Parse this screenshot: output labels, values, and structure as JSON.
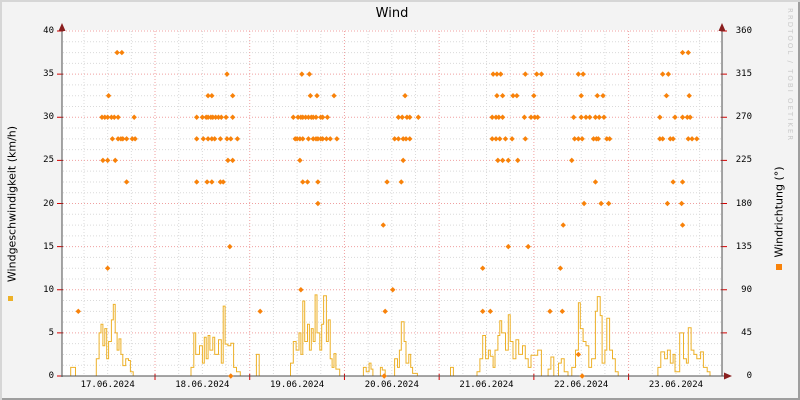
{
  "title": "Wind",
  "watermark": "RRDTOOL / TOBI OETIKER",
  "axes": {
    "left": {
      "label": "Windgeschwindigkeit (km/h)",
      "min": 0,
      "max": 40,
      "ticks": [
        0,
        5,
        10,
        15,
        20,
        25,
        30,
        35,
        40
      ]
    },
    "right": {
      "label": "Windrichtung (°)",
      "min": 0,
      "max": 360,
      "ticks": [
        0,
        45,
        90,
        135,
        180,
        225,
        270,
        315,
        360
      ]
    },
    "x": {
      "unit": "days since 17.06.2024 00:00",
      "t_min": 0.028,
      "t_max": 6.988,
      "day_labels": [
        {
          "t": 0.5,
          "text": "17.06.2024"
        },
        {
          "t": 1.5,
          "text": "18.06.2024"
        },
        {
          "t": 2.5,
          "text": "19.06.2024"
        },
        {
          "t": 3.5,
          "text": "20.06.2024"
        },
        {
          "t": 4.5,
          "text": "21.06.2024"
        },
        {
          "t": 5.5,
          "text": "22.06.2024"
        },
        {
          "t": 6.5,
          "text": "23.06.2024"
        }
      ]
    }
  },
  "colors": {
    "background": "#f3f3f3",
    "plot_background": "#ffffff",
    "grid_minor": "#dadada",
    "grid_major": "#f0a0a0",
    "tick_red": "#d40000",
    "axis": "#4d4d4d",
    "arrow": "#8a1f1f",
    "speed_line": "#edb128",
    "direction_point": "#f8820a",
    "watermark": "#c9c9c9"
  },
  "chart_data": {
    "type": "mixed",
    "title": "Wind",
    "grid": true,
    "legend_position": "axis-side-swatches",
    "x_unit": "days since 17.06.2024 00:00",
    "series": [
      {
        "name": "Windgeschwindigkeit",
        "type": "line",
        "style": "step",
        "axis": "left",
        "unit": "km/h",
        "ylim": [
          0,
          40
        ],
        "step_points": [
          [
            0.03,
            0
          ],
          [
            0.11,
            1
          ],
          [
            0.16,
            0
          ],
          [
            0.38,
            2
          ],
          [
            0.41,
            5
          ],
          [
            0.43,
            6
          ],
          [
            0.45,
            3.5
          ],
          [
            0.47,
            5.5
          ],
          [
            0.49,
            2
          ],
          [
            0.51,
            4
          ],
          [
            0.54,
            6.5
          ],
          [
            0.56,
            8.3
          ],
          [
            0.58,
            5
          ],
          [
            0.6,
            3
          ],
          [
            0.62,
            4.3
          ],
          [
            0.64,
            2.5
          ],
          [
            0.66,
            1.2
          ],
          [
            0.69,
            2
          ],
          [
            0.72,
            1.8
          ],
          [
            0.74,
            0.5
          ],
          [
            0.77,
            0
          ],
          [
            1.38,
            1
          ],
          [
            1.41,
            5
          ],
          [
            1.43,
            2.5
          ],
          [
            1.47,
            3.5
          ],
          [
            1.5,
            1.5
          ],
          [
            1.52,
            4.5
          ],
          [
            1.54,
            2
          ],
          [
            1.56,
            4.7
          ],
          [
            1.58,
            3
          ],
          [
            1.61,
            4.5
          ],
          [
            1.63,
            2.5
          ],
          [
            1.67,
            4.2
          ],
          [
            1.7,
            1.5
          ],
          [
            1.72,
            8.1
          ],
          [
            1.74,
            3.7
          ],
          [
            1.77,
            3.5
          ],
          [
            1.8,
            3.8
          ],
          [
            1.83,
            1
          ],
          [
            1.86,
            0.5
          ],
          [
            1.9,
            0
          ],
          [
            2.07,
            2.5
          ],
          [
            2.1,
            0
          ],
          [
            2.43,
            1.5
          ],
          [
            2.46,
            4
          ],
          [
            2.49,
            3
          ],
          [
            2.52,
            5
          ],
          [
            2.54,
            2.5
          ],
          [
            2.56,
            8.7
          ],
          [
            2.58,
            4
          ],
          [
            2.61,
            6
          ],
          [
            2.63,
            3
          ],
          [
            2.65,
            5.5
          ],
          [
            2.67,
            4
          ],
          [
            2.69,
            9.4
          ],
          [
            2.71,
            5
          ],
          [
            2.74,
            3
          ],
          [
            2.76,
            6
          ],
          [
            2.78,
            9.3
          ],
          [
            2.81,
            4
          ],
          [
            2.83,
            6.5
          ],
          [
            2.85,
            2
          ],
          [
            2.87,
            1
          ],
          [
            2.89,
            2.6
          ],
          [
            2.91,
            0.8
          ],
          [
            2.95,
            0
          ],
          [
            3.2,
            1
          ],
          [
            3.23,
            0.5
          ],
          [
            3.26,
            1.5
          ],
          [
            3.28,
            0.8
          ],
          [
            3.3,
            0
          ],
          [
            3.38,
            1
          ],
          [
            3.4,
            0.7
          ],
          [
            3.43,
            0
          ],
          [
            3.53,
            2
          ],
          [
            3.56,
            1
          ],
          [
            3.58,
            3
          ],
          [
            3.6,
            6.3
          ],
          [
            3.63,
            4
          ],
          [
            3.65,
            1.5
          ],
          [
            3.68,
            2.5
          ],
          [
            3.7,
            1
          ],
          [
            3.72,
            0.3
          ],
          [
            3.77,
            0
          ],
          [
            4.12,
            1
          ],
          [
            4.15,
            0
          ],
          [
            4.4,
            0.5
          ],
          [
            4.43,
            2
          ],
          [
            4.46,
            4.7
          ],
          [
            4.49,
            2
          ],
          [
            4.52,
            3
          ],
          [
            4.54,
            2.3
          ],
          [
            4.57,
            1
          ],
          [
            4.59,
            3
          ],
          [
            4.62,
            4.7
          ],
          [
            4.64,
            6.4
          ],
          [
            4.66,
            5
          ],
          [
            4.7,
            3
          ],
          [
            4.73,
            7.1
          ],
          [
            4.75,
            4
          ],
          [
            4.78,
            2
          ],
          [
            4.81,
            4.2
          ],
          [
            4.84,
            2.5
          ],
          [
            4.88,
            3.5
          ],
          [
            4.91,
            2
          ],
          [
            4.94,
            1
          ],
          [
            4.97,
            2.4
          ],
          [
            5.04,
            3
          ],
          [
            5.08,
            0
          ],
          [
            5.15,
            0.8
          ],
          [
            5.18,
            2.2
          ],
          [
            5.21,
            0
          ],
          [
            5.26,
            1.5
          ],
          [
            5.29,
            2
          ],
          [
            5.32,
            0.5
          ],
          [
            5.36,
            0
          ],
          [
            5.4,
            1
          ],
          [
            5.44,
            3
          ],
          [
            5.47,
            8.5
          ],
          [
            5.49,
            5.5
          ],
          [
            5.52,
            4
          ],
          [
            5.55,
            3.5
          ],
          [
            5.58,
            1
          ],
          [
            5.61,
            2
          ],
          [
            5.65,
            7.5
          ],
          [
            5.67,
            9.2
          ],
          [
            5.7,
            7
          ],
          [
            5.72,
            1.5
          ],
          [
            5.75,
            3
          ],
          [
            5.77,
            6.7
          ],
          [
            5.8,
            3
          ],
          [
            5.83,
            2
          ],
          [
            5.86,
            0.5
          ],
          [
            5.89,
            0
          ],
          [
            6.31,
            1
          ],
          [
            6.34,
            2.8
          ],
          [
            6.38,
            2
          ],
          [
            6.41,
            3
          ],
          [
            6.44,
            1.5
          ],
          [
            6.47,
            2.5
          ],
          [
            6.49,
            0.5
          ],
          [
            6.54,
            5
          ],
          [
            6.58,
            2
          ],
          [
            6.61,
            1.5
          ],
          [
            6.63,
            5.6
          ],
          [
            6.66,
            3
          ],
          [
            6.69,
            2.5
          ],
          [
            6.72,
            2
          ],
          [
            6.76,
            2.8
          ],
          [
            6.79,
            1
          ],
          [
            6.83,
            0.5
          ],
          [
            6.86,
            0
          ],
          [
            6.99,
            0
          ]
        ]
      },
      {
        "name": "Windrichtung",
        "type": "scatter",
        "marker": "diamond",
        "axis": "right",
        "unit": "deg",
        "ylim": [
          0,
          360
        ],
        "groups": [
          {
            "deg": 337.5,
            "t": [
              0.6,
              0.65,
              6.57,
              6.63
            ]
          },
          {
            "deg": 315,
            "t": [
              1.76,
              2.55,
              2.63,
              4.57,
              4.61,
              4.65,
              4.91,
              5.03,
              5.08,
              5.47,
              5.52,
              6.36,
              6.42
            ]
          },
          {
            "deg": 292.5,
            "t": [
              0.51,
              1.56,
              1.6,
              1.82,
              2.64,
              2.71,
              2.89,
              3.64,
              4.61,
              4.67,
              4.78,
              4.82,
              5.0,
              5.5,
              5.67,
              5.73,
              6.4,
              6.64
            ]
          },
          {
            "deg": 270,
            "t": [
              0.44,
              0.47,
              0.5,
              0.54,
              0.57,
              0.61,
              0.78,
              1.44,
              1.5,
              1.54,
              1.56,
              1.59,
              1.61,
              1.64,
              1.67,
              1.7,
              1.75,
              1.82,
              2.46,
              2.51,
              2.54,
              2.56,
              2.59,
              2.62,
              2.65,
              2.67,
              2.7,
              2.75,
              2.77,
              2.82,
              3.57,
              3.61,
              3.66,
              3.69,
              3.78,
              4.56,
              4.6,
              4.63,
              4.67,
              4.9,
              4.97,
              5.01,
              5.04,
              5.42,
              5.5,
              5.55,
              5.59,
              5.65,
              5.69,
              5.74,
              6.33,
              6.49,
              6.57,
              6.62,
              6.65
            ]
          },
          {
            "deg": 247.5,
            "t": [
              0.55,
              0.61,
              0.64,
              0.66,
              0.7,
              0.76,
              0.79,
              1.44,
              1.51,
              1.56,
              1.6,
              1.63,
              1.69,
              1.76,
              1.8,
              1.87,
              2.48,
              2.5,
              2.53,
              2.56,
              2.62,
              2.67,
              2.7,
              2.72,
              2.75,
              2.77,
              2.81,
              2.85,
              2.92,
              3.53,
              3.57,
              3.62,
              3.65,
              3.69,
              4.56,
              4.6,
              4.64,
              4.7,
              4.77,
              4.91,
              5.43,
              5.47,
              5.51,
              5.63,
              5.66,
              5.68,
              5.77,
              5.8,
              6.33,
              6.36,
              6.44,
              6.47,
              6.63,
              6.67,
              6.72
            ]
          },
          {
            "deg": 225,
            "t": [
              0.45,
              0.5,
              0.58,
              1.77,
              1.82,
              2.53,
              3.62,
              4.62,
              4.67,
              4.73,
              4.83,
              5.4
            ]
          },
          {
            "deg": 202.5,
            "t": [
              0.7,
              1.44,
              1.55,
              1.6,
              1.69,
              1.72,
              2.56,
              2.61,
              2.72,
              3.45,
              3.6,
              5.65,
              6.47,
              6.57
            ]
          },
          {
            "deg": 180,
            "t": [
              2.72,
              5.53,
              5.71,
              5.79,
              6.41,
              6.56
            ]
          },
          {
            "deg": 157.5,
            "t": [
              3.41,
              5.31,
              6.57
            ]
          },
          {
            "deg": 135,
            "t": [
              1.79,
              4.73,
              4.94
            ]
          },
          {
            "deg": 112.5,
            "t": [
              0.5,
              4.46,
              5.28
            ]
          },
          {
            "deg": 90,
            "t": [
              2.54,
              3.51
            ]
          },
          {
            "deg": 67.5,
            "t": [
              0.19,
              2.11,
              3.43,
              4.46,
              4.54,
              5.17,
              5.3
            ]
          },
          {
            "deg": 22.5,
            "t": [
              5.47
            ]
          },
          {
            "deg": 0,
            "t": [
              1.8,
              3.42,
              5.51
            ]
          }
        ]
      }
    ]
  }
}
